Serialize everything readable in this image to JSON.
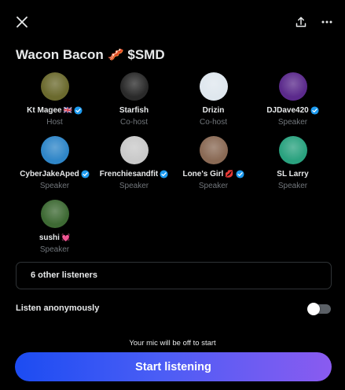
{
  "header": {
    "close_icon": "close-icon",
    "share_icon": "share-icon",
    "more_icon": "more-icon"
  },
  "title": "Wacon Bacon 🥓 $SMD",
  "participants": [
    {
      "name": "Kt Magee",
      "emoji": "🇬🇧",
      "verified": true,
      "role": "Host",
      "avatar_color": "#6b6a2e"
    },
    {
      "name": "Starfish",
      "emoji": "",
      "verified": false,
      "role": "Co-host",
      "avatar_color": "#2a2a2a"
    },
    {
      "name": "Drizin",
      "emoji": "",
      "verified": false,
      "role": "Co-host",
      "avatar_color": "#dfe7ee"
    },
    {
      "name": "DJDave420",
      "emoji": "",
      "verified": true,
      "role": "Speaker",
      "avatar_color": "#5b2a8c"
    },
    {
      "name": "CyberJakeAped",
      "emoji": "",
      "verified": true,
      "role": "Speaker",
      "avatar_color": "#2f86c8"
    },
    {
      "name": "Frenchiesandfit",
      "emoji": "",
      "verified": true,
      "role": "Speaker",
      "avatar_color": "#c9c9c9"
    },
    {
      "name": "Lone's Girl",
      "emoji": "💋",
      "verified": true,
      "role": "Speaker",
      "avatar_color": "#8a6a55"
    },
    {
      "name": "SL Larry",
      "emoji": "",
      "verified": false,
      "role": "Speaker",
      "avatar_color": "#2aa27f"
    },
    {
      "name": "sushi",
      "emoji": "💓",
      "verified": false,
      "role": "Speaker",
      "avatar_color": "#3e6a34"
    }
  ],
  "listeners": {
    "label": "6 other listeners"
  },
  "anonymous": {
    "label": "Listen anonymously",
    "enabled": false
  },
  "footer": {
    "mic_note": "Your mic will be off to start",
    "start_label": "Start listening"
  },
  "colors": {
    "accent_verified": "#1d9bf0",
    "muted_text": "#71767b",
    "button_start": "#1c4cf2",
    "button_end": "#8a5bf0"
  }
}
